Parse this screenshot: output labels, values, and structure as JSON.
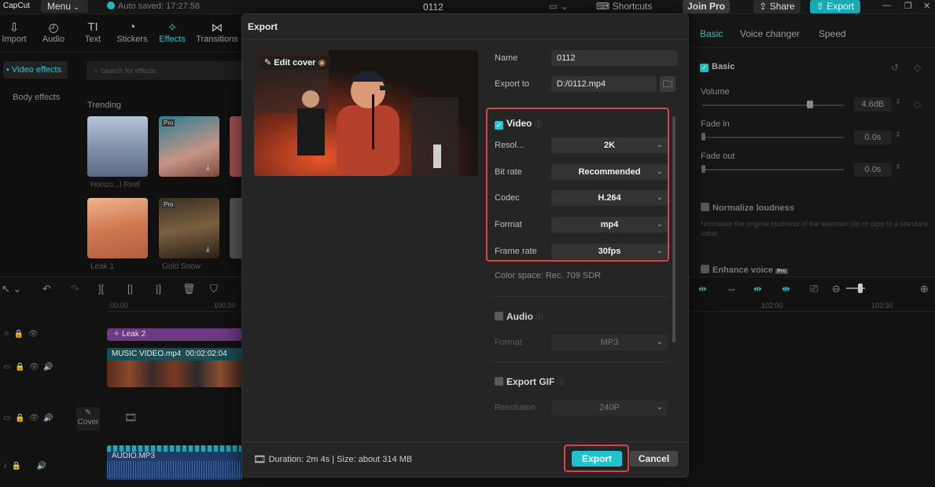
{
  "app": {
    "logo": "CapCut",
    "menu_label": "Menu",
    "autosave": "Auto saved: 17:27:58",
    "project_title": "0112",
    "shortcuts_label": "Shortcuts",
    "join_pro_label": "Join Pro",
    "share_label": "Share",
    "export_label": "Export"
  },
  "toolbar": [
    {
      "label": "Import",
      "icon": "import-icon"
    },
    {
      "label": "Audio",
      "icon": "audio-icon"
    },
    {
      "label": "Text",
      "icon": "text-icon"
    },
    {
      "label": "Stickers",
      "icon": "stickers-icon"
    },
    {
      "label": "Effects",
      "icon": "effects-icon"
    },
    {
      "label": "Transitions",
      "icon": "transitions-icon"
    }
  ],
  "sidebar": {
    "video_effects": "• Video effects",
    "body_effects": "Body effects"
  },
  "effects": {
    "search_placeholder": "Search for effects",
    "trending_label": "Trending",
    "items": [
      "Horizo...l Reel",
      "Leak 1",
      "Gold Snow"
    ]
  },
  "right_panel": {
    "tabs": [
      "Basic",
      "Voice changer",
      "Speed"
    ],
    "section_basic": "Basic",
    "volume_label": "Volume",
    "volume_value": "4.6dB",
    "fade_in_label": "Fade in",
    "fade_in_value": "0.0s",
    "fade_out_label": "Fade out",
    "fade_out_value": "0.0s",
    "normalize_label": "Normalize loudness",
    "normalize_desc": "Normalize the original loudness of the selected clip or clips to a standard value",
    "enhance_label": "Enhance voice"
  },
  "timeline": {
    "times": [
      "00:00",
      "100:30",
      "102:00",
      "103:30"
    ],
    "leak_clip": "Leak 2",
    "video_clip_name": "MUSIC VIDEO.mp4",
    "video_clip_duration": "00:02:02:04",
    "cover_label": "Cover",
    "audio_clip": "AUDIO.MP3"
  },
  "export_dialog": {
    "title": "Export",
    "edit_cover": "Edit cover",
    "name_label": "Name",
    "name_value": "0112",
    "export_to_label": "Export to",
    "export_to_value": "D:/0112.mp4",
    "video": {
      "title": "Video",
      "resolution_label": "Resol...",
      "resolution_value": "2K",
      "bitrate_label": "Bit rate",
      "bitrate_value": "Recommended",
      "codec_label": "Codec",
      "codec_value": "H.264",
      "format_label": "Format",
      "format_value": "mp4",
      "framerate_label": "Frame rate",
      "framerate_value": "30fps",
      "color_space": "Color space: Rec. 709 SDR"
    },
    "audio": {
      "title": "Audio",
      "format_label": "Format",
      "format_value": "MP3"
    },
    "gif": {
      "title": "Export GIF",
      "resolution_label": "Resolution",
      "resolution_value": "240P"
    },
    "duration_info": "Duration: 2m 4s | Size: about 314 MB",
    "export_button": "Export",
    "cancel_button": "Cancel"
  },
  "colors": {
    "accent": "#1fc3cf",
    "highlight_box": "#e0423f",
    "dialog_bg": "#252525"
  }
}
